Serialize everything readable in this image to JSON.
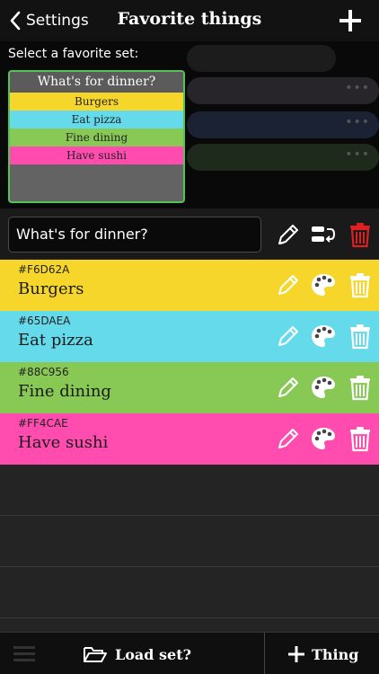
{
  "header": {
    "back_label": "Settings",
    "title": "Favorite things",
    "add_icon": "plus-icon"
  },
  "picker": {
    "label": "Select a favorite set:",
    "selected_set": {
      "title": "What's for dinner?",
      "items": [
        {
          "label": "Burgers",
          "color": "#F6D62A"
        },
        {
          "label": "Eat pizza",
          "color": "#65DAEA"
        },
        {
          "label": "Fine dining",
          "color": "#88C956"
        },
        {
          "label": "Have sushi",
          "color": "#FF4CAE"
        }
      ]
    },
    "other_set_colors": [
      "#1c1c1c",
      "#27252a",
      "#1a2233",
      "#1e2a1c"
    ]
  },
  "set_name": {
    "value": "What's for dinner?",
    "actions": [
      "pencil-icon",
      "reorder-icon",
      "trash-icon"
    ],
    "delete_color": "#E02020"
  },
  "things": [
    {
      "hex": "#F6D62A",
      "name": "Burgers",
      "color": "#F6D62A"
    },
    {
      "hex": "#65DAEA",
      "name": "Eat pizza",
      "color": "#65DAEA"
    },
    {
      "hex": "#88C956",
      "name": "Fine dining",
      "color": "#88C956"
    },
    {
      "hex": "#FF4CAE",
      "name": "Have sushi",
      "color": "#FF4CAE"
    }
  ],
  "footer": {
    "load_label": "Load set?",
    "add_thing_label": "Thing"
  },
  "colors": {
    "accent_green": "#56C25A",
    "background": "#242424"
  }
}
